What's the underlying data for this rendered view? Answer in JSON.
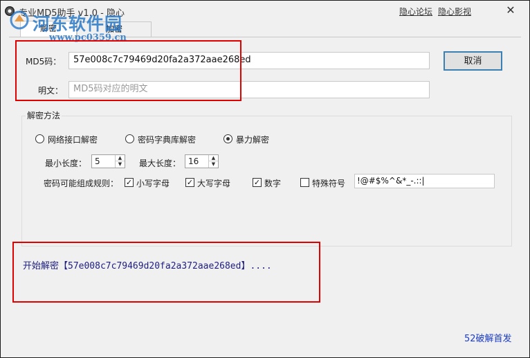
{
  "window": {
    "title": "专业MD5助手 v1.0 - 隐心",
    "links": {
      "forum": "隐心论坛",
      "video": "隐心影视"
    },
    "close_glyph": "✕"
  },
  "watermark": {
    "text": "河东软件园",
    "url": "www.pc0359.cn"
  },
  "tabs": [
    {
      "label": "解密",
      "active": true
    },
    {
      "label": "加密",
      "active": false
    }
  ],
  "md5": {
    "label": "MD5码：",
    "value": "57e008c7c79469d20fa2a372aae268ed"
  },
  "plaintext": {
    "label": "明文：",
    "placeholder": "MD5码对应的明文"
  },
  "cancel_button": "取消",
  "method": {
    "title": "解密方法",
    "options": [
      {
        "label": "网络接口解密",
        "checked": false
      },
      {
        "label": "密码字典库解密",
        "checked": false
      },
      {
        "label": "暴力解密",
        "checked": true
      }
    ],
    "min_length": {
      "label": "最小长度：",
      "value": "5"
    },
    "max_length": {
      "label": "最大长度：",
      "value": "16"
    },
    "rules_label": "密码可能组成规则：",
    "rules": [
      {
        "label": "小写字母",
        "checked": true
      },
      {
        "label": "大写字母",
        "checked": true
      },
      {
        "label": "数字",
        "checked": true
      },
      {
        "label": "特殊符号",
        "checked": false
      }
    ],
    "special_chars": "!@#$%^&*_-.::|"
  },
  "status": "开始解密【57e008c7c79469d20fa2a372aae268ed】....",
  "footer_link": "52破解首发",
  "colors": {
    "highlight_box": "#e00000",
    "status_text": "#202080",
    "link": "#1a3cc8"
  }
}
